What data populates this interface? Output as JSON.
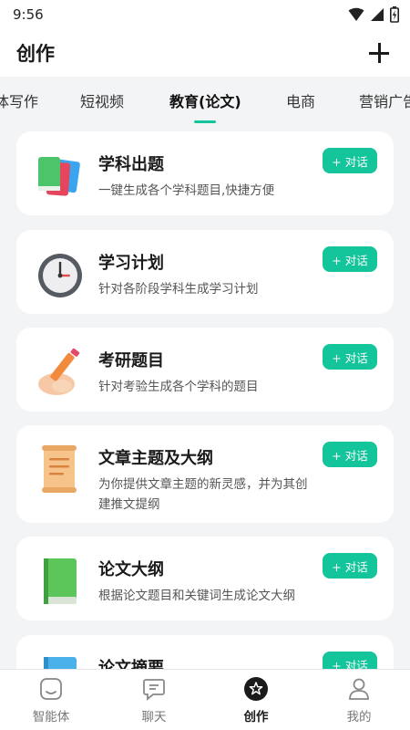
{
  "status_bar": {
    "time": "9:56"
  },
  "header": {
    "title": "创作"
  },
  "tabs": [
    {
      "label": "体写作",
      "active": false
    },
    {
      "label": "短视频",
      "active": false
    },
    {
      "label": "教育(论文)",
      "active": true
    },
    {
      "label": "电商",
      "active": false
    },
    {
      "label": "营销广告",
      "active": false
    }
  ],
  "cards": [
    {
      "title": "学科出题",
      "desc": "一键生成各个学科题目,快捷方便",
      "button": "+ 对话",
      "icon": "books-icon"
    },
    {
      "title": "学习计划",
      "desc": "针对各阶段学科生成学习计划",
      "button": "+ 对话",
      "icon": "clock-icon"
    },
    {
      "title": "考研题目",
      "desc": "针对考验生成各个学科的题目",
      "button": "+ 对话",
      "icon": "pencil-hand-icon"
    },
    {
      "title": "文章主题及大纲",
      "desc": "为你提供文章主题的新灵感，并为其创建推文提纲",
      "button": "+ 对话",
      "icon": "scroll-icon"
    },
    {
      "title": "论文大纲",
      "desc": "根据论文题目和关键词生成论文大纲",
      "button": "+ 对话",
      "icon": "green-book-icon"
    },
    {
      "title": "论文摘要",
      "desc": "",
      "button": "+ 对话",
      "icon": "blue-book-icon"
    }
  ],
  "bottom_nav": [
    {
      "label": "智能体",
      "icon": "agent-icon",
      "active": false
    },
    {
      "label": "聊天",
      "icon": "chat-icon",
      "active": false
    },
    {
      "label": "创作",
      "icon": "create-icon",
      "active": true
    },
    {
      "label": "我的",
      "icon": "profile-icon",
      "active": false
    }
  ],
  "colors": {
    "accent": "#14c49a",
    "background": "#f3f4f6",
    "card": "#ffffff"
  }
}
